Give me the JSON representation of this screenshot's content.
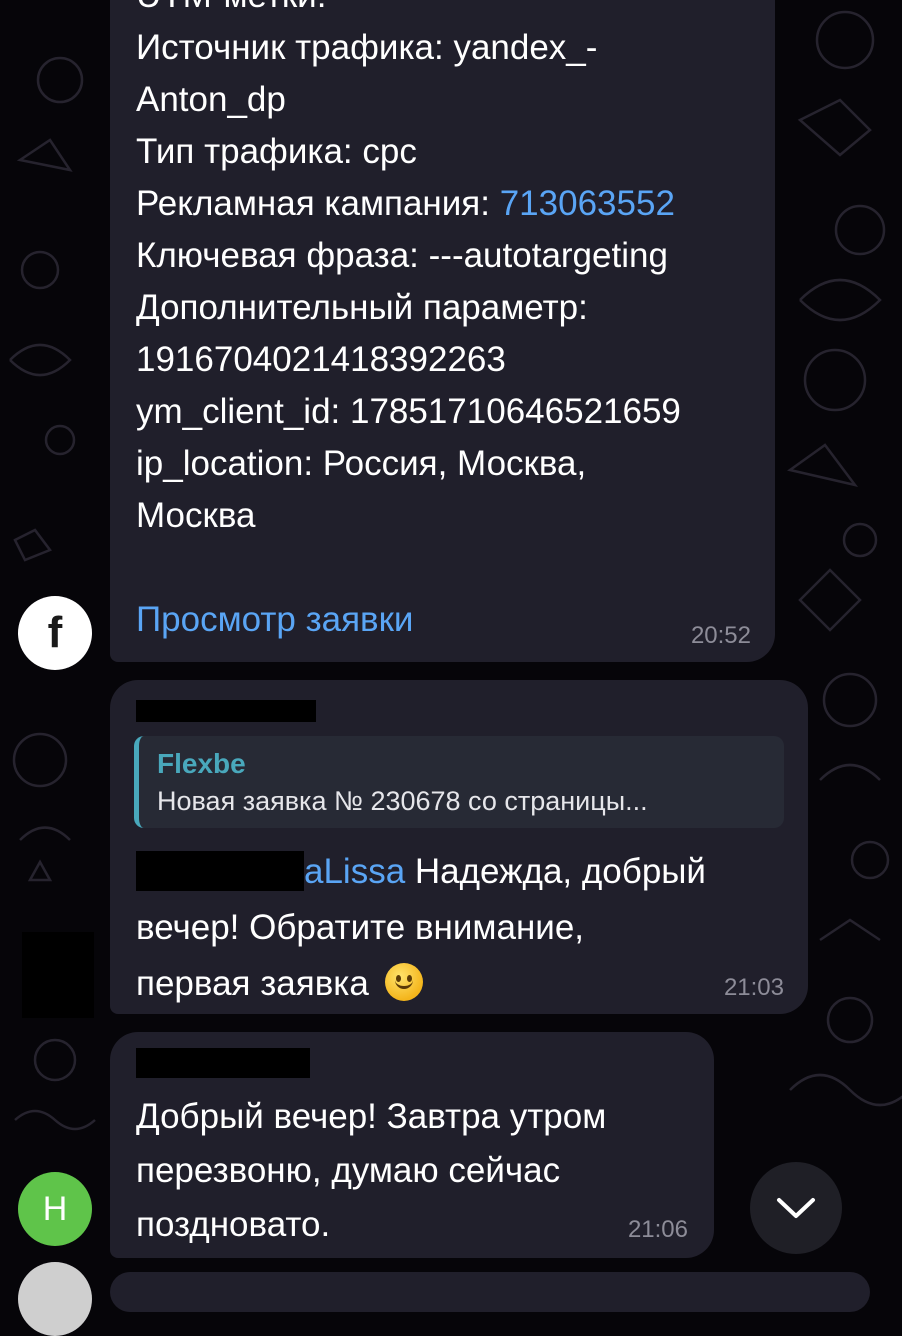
{
  "message1": {
    "cut_header": "UTM-метки:",
    "lines": [
      "Источник трафика: yandex_-",
      "Anton_dp",
      "Тип трафика: cpc",
      "Рекламная кампания: ",
      "Ключевая фраза: ---autotargeting",
      "Дополнительный параметр:",
      "19167040214183922​63",
      "ym_client_id: 1785171064652165​9",
      "ip_location: Россия, Москва,",
      "Москва"
    ],
    "campaign_id_link": "713063552",
    "view_link": "Просмотр заявки",
    "time": "20:52"
  },
  "message2": {
    "reply_title": "Flexbe",
    "reply_text": "Новая заявка № 230678 со страницы...",
    "mention_suffix": "aLissa",
    "text_line1": " Надежда, добрый",
    "text_line2": "вечер! Обратите внимание,",
    "text_line3": "первая заявка",
    "time": "21:03"
  },
  "message3": {
    "text_line1": "Добрый вечер! Завтра утром",
    "text_line2": "перезвоню, думаю сейчас",
    "text_line3": "поздновато.",
    "time": "21:06"
  },
  "avatars": {
    "facebook_letter": "f",
    "h_letter": "H"
  },
  "colors": {
    "background": "#060509",
    "bubble": "#201f2b",
    "link": "#5aa5f5",
    "reply_accent": "#49a8bc",
    "time": "#8d8c98",
    "avatar_h": "#5fc44a"
  }
}
